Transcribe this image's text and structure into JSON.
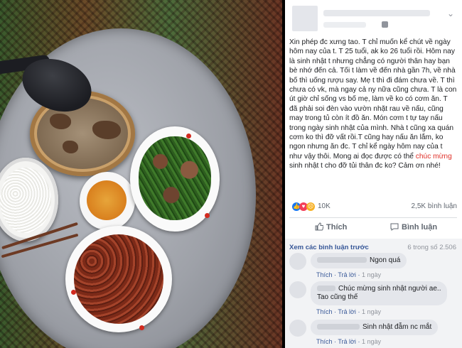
{
  "post": {
    "text_before": "Xin phép đc xưng tao. T chỉ muốn kể chút về ngày hôm nay của t. T 25 tuổi, ak ko 26 tuổi rồi. Hôm nay là sinh nhật t nhưng chẳng có người thân hay bạn bè nhớ đến cả. Tối t làm về đến nhà gần 7h, về nhà bố thì uống rượu say. Mẹ t thì đi đám chưa về. T thì chưa có vk, mà ngay cả ny nữa cũng chưa. T là con út giờ chỉ sống vs bố mẹ, làm về ko có cơm ăn. T đã phải soi đèn vào vườn nhặt rau về nấu, cũng may trong tủ còn ít đồ ăn. Món cơm t tự tay nấu trong ngày sinh nhật của mình. Nhà t cũng xa quán cơm ko thì đỡ vất rồi.T cũng hay nấu ăn lắm, ko ngon nhưng ăn đc. T chỉ kể ngày hôm nay của t như vậy thôi. Mong ai đọc được có thể ",
    "highlight": "chúc mừng",
    "text_after": " sinh nhật t cho đỡ tủi thân đc ko? Cảm ơn nhé!"
  },
  "stats": {
    "reactions_count": "10K",
    "comments_count": "2,5K bình luận",
    "reaction_icons": [
      "like-icon",
      "love-icon",
      "sad-icon"
    ]
  },
  "actions": {
    "like_label": "Thích",
    "comment_label": "Bình luận"
  },
  "comments_section": {
    "view_more": "Xem các bình luận trước",
    "paging": "6 trong số 2.506",
    "items": [
      {
        "text": "Ngon quá",
        "like": "Thích",
        "reply": "Trả lời",
        "time": "1 ngày"
      },
      {
        "text": "Chúc mừng sinh nhật người ae..",
        "text2": "Tao cũng thế",
        "like": "Thích",
        "reply": "Trả lời",
        "time": "1 ngày"
      },
      {
        "text": "Sinh nhật đẫm nc mắt",
        "like": "Thích",
        "reply": "Trả lời",
        "time": "1 ngày"
      }
    ]
  },
  "colors": {
    "link": "#385898",
    "highlight": "#e0312a",
    "text": "#1c1e21",
    "muted": "#606770"
  }
}
